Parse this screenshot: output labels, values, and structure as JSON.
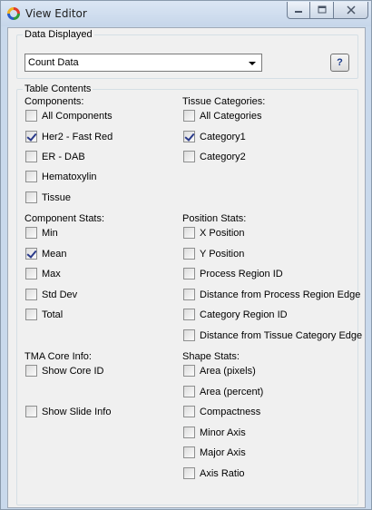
{
  "window": {
    "title": "View Editor"
  },
  "data_displayed": {
    "group_title": "Data Displayed",
    "selected": "Count Data",
    "help_label": "?"
  },
  "table_contents": {
    "group_title": "Table Contents",
    "components": {
      "heading": "Components:",
      "items": [
        {
          "label": "All Components",
          "checked": false
        },
        {
          "label": "Her2 - Fast Red",
          "checked": true
        },
        {
          "label": "ER - DAB",
          "checked": false
        },
        {
          "label": "Hematoxylin",
          "checked": false
        },
        {
          "label": "Tissue",
          "checked": false
        }
      ]
    },
    "tissue_categories": {
      "heading": "Tissue Categories:",
      "items": [
        {
          "label": "All Categories",
          "checked": false
        },
        {
          "label": "Category1",
          "checked": true
        },
        {
          "label": "Category2",
          "checked": false
        }
      ]
    },
    "component_stats": {
      "heading": "Component Stats:",
      "items": [
        {
          "label": "Min",
          "checked": false
        },
        {
          "label": "Mean",
          "checked": true
        },
        {
          "label": "Max",
          "checked": false
        },
        {
          "label": "Std Dev",
          "checked": false
        },
        {
          "label": "Total",
          "checked": false
        }
      ]
    },
    "position_stats": {
      "heading": "Position Stats:",
      "items": [
        {
          "label": "X Position",
          "checked": false
        },
        {
          "label": "Y Position",
          "checked": false
        },
        {
          "label": "Process Region ID",
          "checked": false
        },
        {
          "label": "Distance from Process Region Edge",
          "checked": false
        },
        {
          "label": "Category Region ID",
          "checked": false
        },
        {
          "label": "Distance from Tissue Category Edge",
          "checked": false
        }
      ]
    },
    "tma_core_info": {
      "heading": "TMA Core Info:",
      "items": [
        {
          "label": "Show Core ID",
          "checked": false
        },
        {
          "label": "Show Slide Info",
          "checked": false
        }
      ]
    },
    "shape_stats": {
      "heading": "Shape Stats:",
      "items": [
        {
          "label": "Area (pixels)",
          "checked": false
        },
        {
          "label": "Area (percent)",
          "checked": false
        },
        {
          "label": "Compactness",
          "checked": false
        },
        {
          "label": "Minor Axis",
          "checked": false
        },
        {
          "label": "Major Axis",
          "checked": false
        },
        {
          "label": "Axis Ratio",
          "checked": false
        }
      ]
    }
  }
}
